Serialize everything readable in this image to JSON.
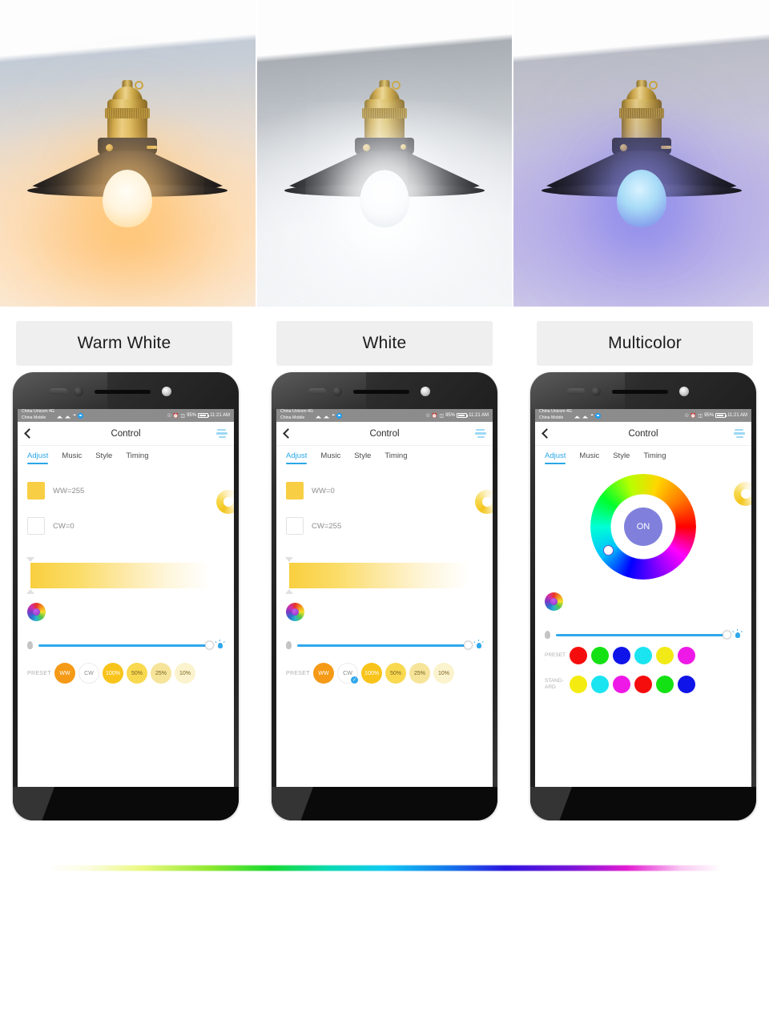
{
  "modes": [
    {
      "label": "Warm White",
      "lamp_glow": "#ffc478"
    },
    {
      "label": "White",
      "lamp_glow": "#ffffff"
    },
    {
      "label": "Multicolor",
      "lamp_glow": "#8b7fe0"
    }
  ],
  "phone": {
    "statusbar": {
      "carrier_line1": "China Unicom 4G",
      "carrier_line2": "China Mobile",
      "wifi_icon": "wifi-icon",
      "eye_icon": "eye-care-icon",
      "alarm_icon": "alarm-icon",
      "vibrate_icon": "vibrate-icon",
      "battery_percent": "95%",
      "time": "11:21 AM"
    },
    "appbar": {
      "back_icon": "back-chevron-icon",
      "title": "Control",
      "menu_icon": "hamburger-menu-icon"
    },
    "tabs": [
      {
        "label": "Adjust",
        "active": true
      },
      {
        "label": "Music",
        "active": false
      },
      {
        "label": "Style",
        "active": false
      },
      {
        "label": "Timing",
        "active": false
      }
    ],
    "accent_color": "#29a7e8"
  },
  "screen_warm": {
    "channels": [
      {
        "swatch": "ww",
        "label": "WW=255"
      },
      {
        "swatch": "cw",
        "label": "CW=0"
      }
    ],
    "preset_label": "PRESET",
    "presets": [
      {
        "label": "WW",
        "color": "#f59a17",
        "text": "light",
        "selected": false
      },
      {
        "label": "CW",
        "color": "#ffffff",
        "text": "dark",
        "selected": false
      },
      {
        "label": "100%",
        "color": "#f8c41b",
        "text": "light",
        "selected": false
      },
      {
        "label": "50%",
        "color": "#f9d94f",
        "text": "dark",
        "selected": false
      },
      {
        "label": "25%",
        "color": "#f6e49a",
        "text": "dark",
        "selected": false
      },
      {
        "label": "10%",
        "color": "#fbf3cd",
        "text": "dark",
        "selected": false
      }
    ]
  },
  "screen_white": {
    "channels": [
      {
        "swatch": "ww",
        "label": "WW=0"
      },
      {
        "swatch": "cw",
        "label": "CW=255"
      }
    ],
    "preset_label": "PRESET",
    "presets": [
      {
        "label": "WW",
        "color": "#f59a17",
        "text": "light",
        "selected": false
      },
      {
        "label": "CW",
        "color": "#ffffff",
        "text": "dark",
        "selected": true
      },
      {
        "label": "100%",
        "color": "#f8c41b",
        "text": "light",
        "selected": false
      },
      {
        "label": "50%",
        "color": "#f9d94f",
        "text": "dark",
        "selected": false
      },
      {
        "label": "25%",
        "color": "#f6e49a",
        "text": "dark",
        "selected": false
      },
      {
        "label": "10%",
        "color": "#fbf3cd",
        "text": "dark",
        "selected": false
      }
    ]
  },
  "screen_color": {
    "power_label": "ON",
    "preset_label": "PRESET",
    "standard_label": "STAND-ARD",
    "preset_colors": [
      "#f50d0d",
      "#14e114",
      "#0f14e8",
      "#1ae4f0",
      "#f2ea16",
      "#ee19e6"
    ],
    "standard_colors": [
      "#f4ec10",
      "#1ae4f0",
      "#ee19e6",
      "#f50d0d",
      "#14e114",
      "#0f14e8"
    ]
  }
}
